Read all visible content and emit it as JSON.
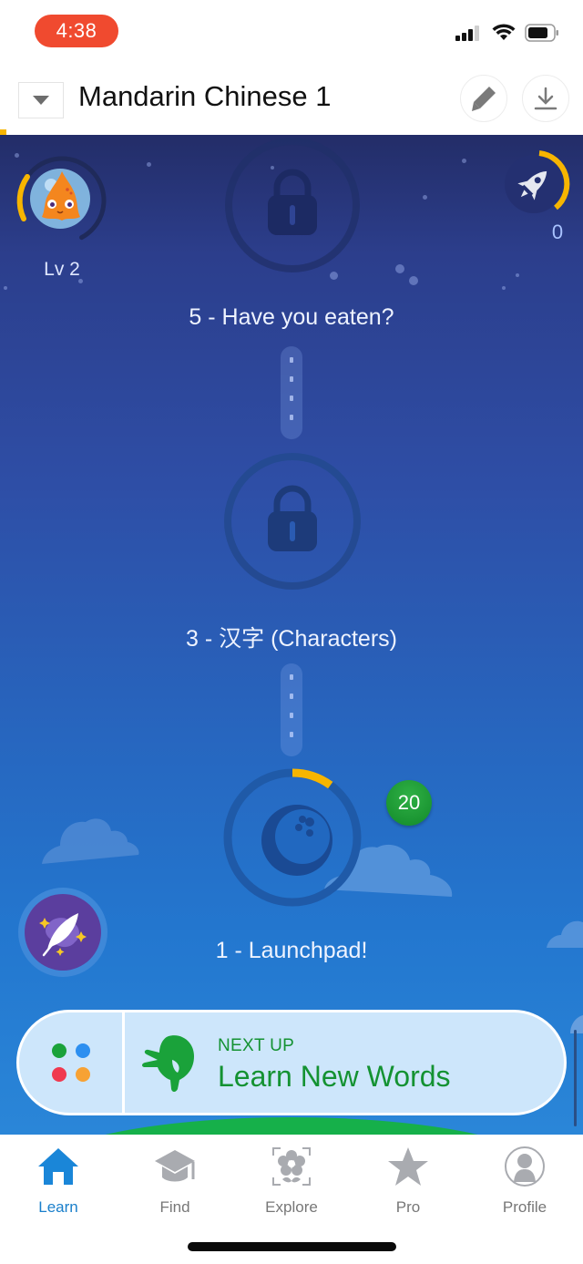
{
  "status_bar": {
    "time": "4:38",
    "icons": [
      "cellular-signal-icon",
      "wifi-icon",
      "battery-icon"
    ]
  },
  "header": {
    "dropdown_icon": "caret-down-icon",
    "course_title": "Mandarin Chinese 1",
    "edit_icon": "pencil-icon",
    "download_icon": "download-icon"
  },
  "player": {
    "level_label": "Lv 2",
    "level_progress": 0.22,
    "avatar": "orange-octopus-astronaut",
    "boost_count": "0",
    "boost_progress": 0.4,
    "boost_icon": "rocket-icon"
  },
  "levels": [
    {
      "label": "5 - Have you eaten?",
      "state": "locked",
      "icon": "lock-icon"
    },
    {
      "label": "3 - 汉字 (Characters)",
      "state": "locked",
      "icon": "lock-icon"
    },
    {
      "label": "1 - Launchpad!",
      "state": "in-progress",
      "icon": "planet-icon",
      "progress": 0.1,
      "badge_count": "20"
    }
  ],
  "mems_button": {
    "icon": "feather-quill-icon"
  },
  "next_up": {
    "kicker": "NEXT UP",
    "title": "Learn New Words",
    "icon": "planting-hand-icon",
    "mode_dots": [
      "#1aa23a",
      "#2d8ff0",
      "#f0394f",
      "#f7a234"
    ]
  },
  "colors": {
    "accent_yellow": "#f7b500",
    "next_up_green": "#149232",
    "active_tab": "#1a7fcb",
    "time_pill": "#f04a2f"
  },
  "tabbar": {
    "active": "learn",
    "tabs": [
      {
        "id": "learn",
        "label": "Learn",
        "icon": "home-icon"
      },
      {
        "id": "find",
        "label": "Find",
        "icon": "graduation-cap-icon"
      },
      {
        "id": "explore",
        "label": "Explore",
        "icon": "flower-scan-icon"
      },
      {
        "id": "pro",
        "label": "Pro",
        "icon": "star-icon"
      },
      {
        "id": "profile",
        "label": "Profile",
        "icon": "person-icon"
      }
    ]
  }
}
